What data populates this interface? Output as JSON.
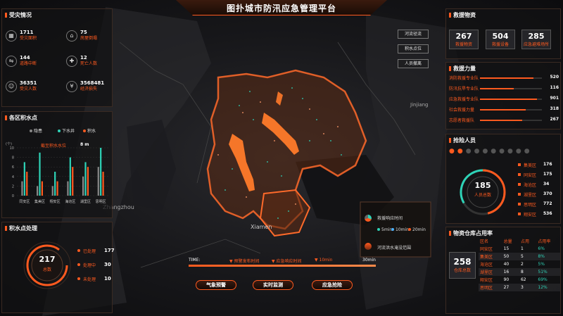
{
  "title": "图扑城市防汛应急管理平台",
  "left": {
    "disaster_title": "受灾情况",
    "stats": [
      {
        "value": "1711",
        "label": "受灾面积",
        "icon": "area-icon"
      },
      {
        "value": "75",
        "label": "房屋倒塌",
        "icon": "house-icon"
      },
      {
        "value": "144",
        "label": "道路中断",
        "icon": "road-icon"
      },
      {
        "value": "12",
        "label": "死亡人数",
        "icon": "death-icon"
      },
      {
        "value": "36351",
        "label": "受灾人数",
        "icon": "people-icon"
      },
      {
        "value": "3568481",
        "label": "经济损失",
        "icon": "money-icon"
      }
    ],
    "water_title": "各区积水点",
    "legend": [
      "隐患",
      "下水井",
      "积水"
    ],
    "water_depth_label": "截至积水水位",
    "water_depth_value": "8 m",
    "y_ticks": [
      "10",
      "8",
      "6",
      "4",
      "2",
      "0"
    ],
    "y_unit": "(个)",
    "districts": [
      "同安区",
      "集美区",
      "翔安区",
      "海沧区",
      "湖里区",
      "思明区"
    ],
    "handle_title": "积水点处理",
    "handle_total": "217",
    "handle_total_label": "总数",
    "handle_items": [
      {
        "label": "已处理",
        "value": "177"
      },
      {
        "label": "处理中",
        "value": "30"
      },
      {
        "label": "未处理",
        "value": "10"
      }
    ]
  },
  "center": {
    "top_buttons": [
      "河流径流",
      "积水点位",
      "人员撤离"
    ],
    "time_label": "TIME:",
    "time_items": [
      "预警发布时间",
      "应急响应时间",
      "10min"
    ],
    "time_end": "30min",
    "bottom_buttons": [
      "气象预警",
      "实时监测",
      "应急抢险"
    ],
    "info_title": "救援响应时间",
    "info_legend": [
      "5min",
      "10min",
      "20min"
    ],
    "info_sub": "河流洪水淹没范围",
    "map_labels": [
      "Xiamen",
      "Zhangzhou",
      "Jinjiang"
    ]
  },
  "right": {
    "materials_title": "救援物资",
    "materials": [
      {
        "value": "267",
        "label": "救援物资"
      },
      {
        "value": "504",
        "label": "救援设备"
      },
      {
        "value": "285",
        "label": "应急避难场所"
      }
    ],
    "rescue_title": "救援力量",
    "rescue": [
      {
        "label": "消防救援专业队",
        "value": "520",
        "pct": 0.86
      },
      {
        "label": "防汛抗旱专业队",
        "value": "116",
        "pct": 0.55
      },
      {
        "label": "应急救援专业队",
        "value": "901",
        "pct": 0.92
      },
      {
        "label": "社会救援力量",
        "value": "318",
        "pct": 0.74
      },
      {
        "label": "志愿者救援队",
        "value": "267",
        "pct": 0.68
      }
    ],
    "personnel_title": "抢险人员",
    "personnel_total": "185",
    "personnel_total_label": "人员总数",
    "personnel": [
      {
        "label": "集美区",
        "value": "176"
      },
      {
        "label": "同安区",
        "value": "175"
      },
      {
        "label": "海沧区",
        "value": "34"
      },
      {
        "label": "湖里区",
        "value": "370"
      },
      {
        "label": "思明区",
        "value": "772"
      },
      {
        "label": "翔安区",
        "value": "536"
      }
    ],
    "warehouse_title": "物资仓库占用率",
    "warehouse_total": "258",
    "warehouse_total_label": "仓库总数",
    "table_headers": [
      "区名",
      "总量",
      "占用",
      "占用率"
    ],
    "table_rows": [
      [
        "同安区",
        "15",
        "1",
        "6%"
      ],
      [
        "集美区",
        "50",
        "5",
        "8%"
      ],
      [
        "海沧区",
        "40",
        "2",
        "5%"
      ],
      [
        "湖里区",
        "16",
        "8",
        "51%"
      ],
      [
        "翔安区",
        "90",
        "62",
        "69%"
      ],
      [
        "思明区",
        "27",
        "3",
        "12%"
      ]
    ]
  },
  "chart_data": {
    "type": "bar",
    "categories": [
      "同安区",
      "集美区",
      "翔安区",
      "海沧区",
      "湖里区",
      "思明区"
    ],
    "series": [
      {
        "name": "隐患",
        "values": [
          3,
          2,
          2,
          3,
          4,
          6
        ]
      },
      {
        "name": "下水井",
        "values": [
          7,
          9,
          5,
          8,
          7,
          10
        ]
      },
      {
        "name": "积水",
        "values": [
          5,
          3,
          3,
          6,
          6,
          5
        ]
      }
    ],
    "ylim": [
      0,
      10
    ],
    "colors": [
      "#888888",
      "#2ed3b7",
      "#ff5a1f"
    ]
  }
}
